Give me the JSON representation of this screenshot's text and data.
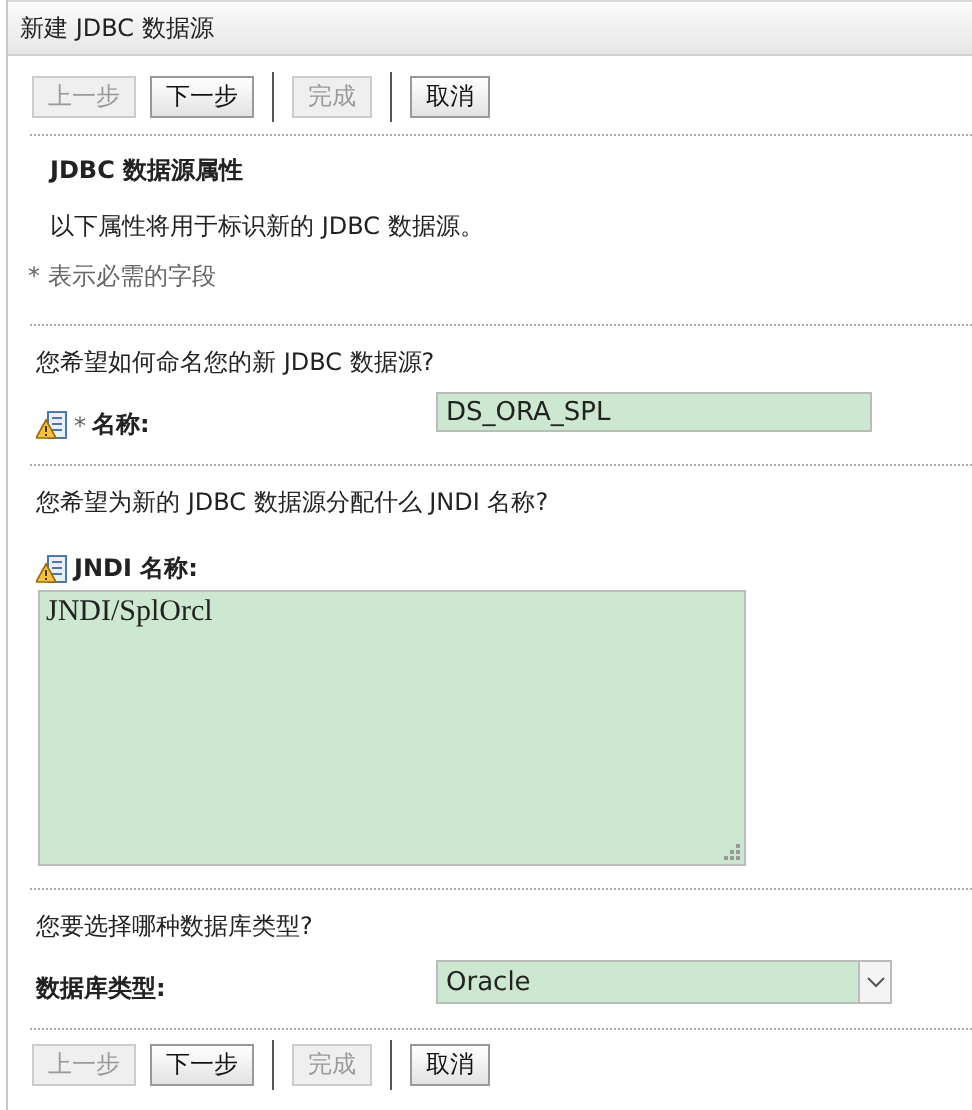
{
  "window": {
    "title": "新建 JDBC 数据源"
  },
  "top_toolbar": [
    {
      "label": "上一步",
      "disabled": true
    },
    {
      "label": "下一步",
      "disabled": false
    },
    {
      "label": "完成",
      "disabled": true
    },
    {
      "label": "取消",
      "disabled": false
    }
  ],
  "heading": "JDBC 数据源属性",
  "description": "以下属性将用于标识新的 JDBC 数据源。",
  "required_note": "* 表示必需的字段",
  "sections": [
    {
      "question": "您希望如何命名您的新 JDBC 数据源?",
      "field": {
        "kind": "text",
        "icon": true,
        "required_mark": "*",
        "label": "名称:",
        "value": "DS_ORA_SPL"
      }
    },
    {
      "question": "您希望为新的 JDBC 数据源分配什么 JNDI 名称?",
      "field": {
        "kind": "textarea",
        "icon": true,
        "label": "JNDI 名称:",
        "value": "JNDI/SplOrcl"
      }
    },
    {
      "question": "您要选择哪种数据库类型?",
      "field": {
        "kind": "select",
        "icon": false,
        "label": "数据库类型:",
        "value": "Oracle"
      }
    }
  ],
  "bottom_toolbar": [
    {
      "label": "上一步",
      "disabled": true
    },
    {
      "label": "下一步",
      "disabled": false
    },
    {
      "label": "完成",
      "disabled": true
    },
    {
      "label": "取消",
      "disabled": false
    }
  ]
}
